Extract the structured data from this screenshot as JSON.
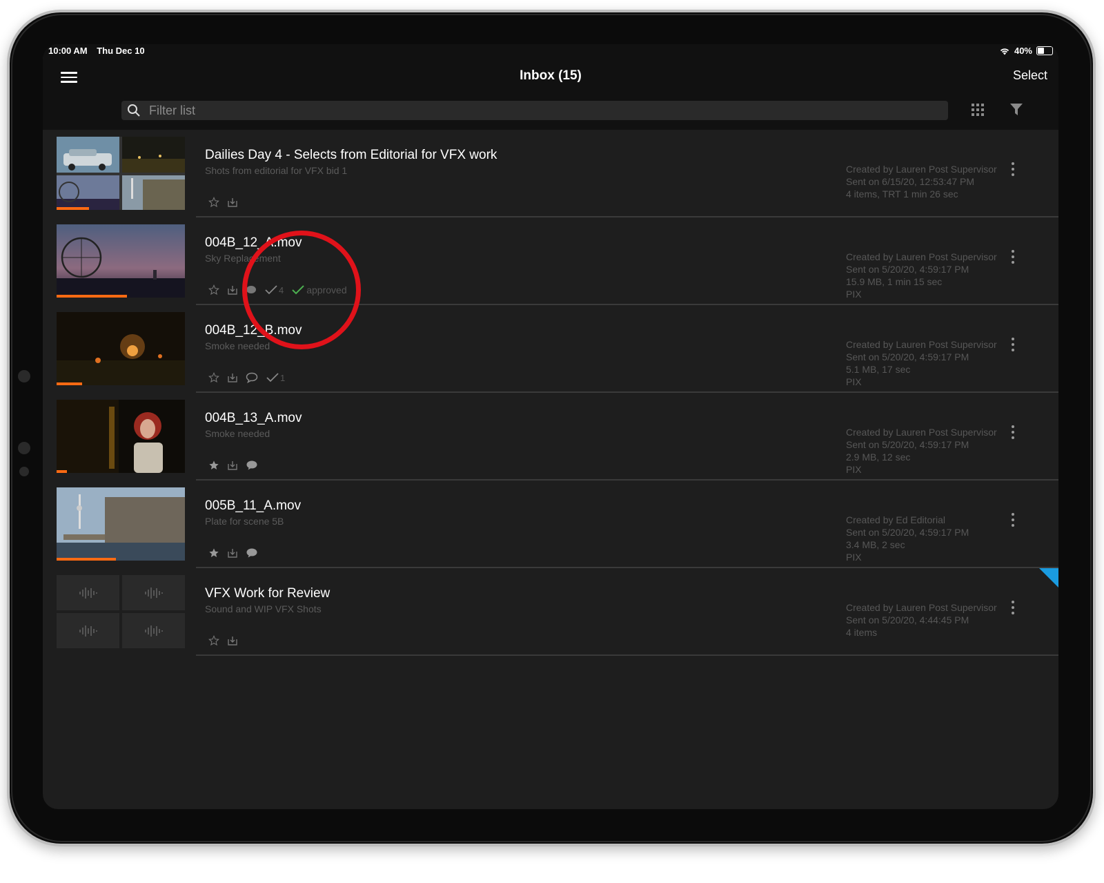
{
  "status_bar": {
    "time": "10:00 AM",
    "date": "Thu Dec 10",
    "battery": "40%",
    "battery_level": 0.4
  },
  "nav": {
    "title": "Inbox (15)",
    "select_label": "Select"
  },
  "search": {
    "placeholder": "Filter list"
  },
  "items": [
    {
      "title": "Dailies Day 4 - Selects from Editorial for VFX work",
      "subtitle": "Shots from editorial for VFX bid 1",
      "meta": [
        "Created by Lauren Post Supervisor",
        "Sent on 6/15/20, 12:53:47 PM",
        "4 items, TRT 1 min 26 sec"
      ],
      "progress": 0.25,
      "starred": false
    },
    {
      "title": "004B_12_A.mov",
      "subtitle": "Sky Replacement",
      "meta": [
        "Created by Lauren Post Supervisor",
        "Sent on 5/20/20, 4:59:17 PM",
        "15.9 MB, 1 min 15 sec",
        "PIX"
      ],
      "progress": 0.55,
      "starred": false,
      "approvals": "4",
      "approved_label": "approved"
    },
    {
      "title": "004B_12_B.mov",
      "subtitle": "Smoke needed",
      "meta": [
        "Created by Lauren Post Supervisor",
        "Sent on 5/20/20, 4:59:17 PM",
        "5.1 MB, 17 sec",
        "PIX"
      ],
      "progress": 0.2,
      "starred": false,
      "approvals": "1"
    },
    {
      "title": "004B_13_A.mov",
      "subtitle": "Smoke needed",
      "meta": [
        "Created by Lauren Post Supervisor",
        "Sent on 5/20/20, 4:59:17 PM",
        "2.9 MB, 12 sec",
        "PIX"
      ],
      "progress": 0.08,
      "starred": true
    },
    {
      "title": "005B_11_A.mov",
      "subtitle": "Plate for scene 5B",
      "meta": [
        "Created by Ed Editorial",
        "Sent on 5/20/20, 4:59:17 PM",
        "3.4 MB, 2 sec",
        "PIX"
      ],
      "progress": 0.46,
      "starred": true
    },
    {
      "title": "VFX Work for Review",
      "subtitle": "Sound and WIP VFX Shots",
      "meta": [
        "Created by Lauren Post Supervisor",
        "Sent on 5/20/20, 4:44:45 PM",
        "4 items"
      ],
      "starred": false,
      "unread": true
    }
  ],
  "colors": {
    "accent": "#ff6a13",
    "unread": "#1a9be0",
    "annotation": "#e0121a",
    "approved": "#4caf50"
  },
  "icons": [
    "menu-icon",
    "search-icon",
    "grid-icon",
    "filter-icon",
    "star-icon",
    "download-icon",
    "comment-icon",
    "check-icon",
    "more-icon",
    "waveform-icon"
  ]
}
